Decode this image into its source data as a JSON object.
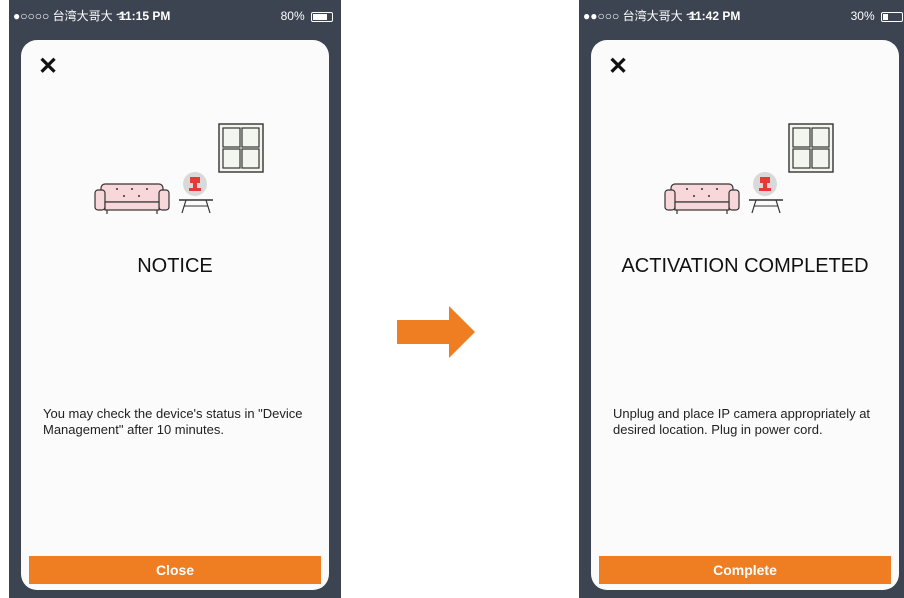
{
  "colors": {
    "accent": "#ef7d22",
    "phone_bg": "#3b4450",
    "card_bg": "#fbfbfb"
  },
  "left_screen": {
    "status": {
      "carrier": "●○○○○ 台湾大哥大 ᯤ",
      "time": "11:15 PM",
      "battery": "80%",
      "battery_level": 0.8
    },
    "title": "NOTICE",
    "description": "You may check the device's status in \"Device Management\" after 10 minutes.",
    "button_label": "Close"
  },
  "right_screen": {
    "status": {
      "carrier": "●●○○○ 台湾大哥大 ᯤ",
      "time": "11:42 PM",
      "battery": "30%",
      "battery_level": 0.3
    },
    "title": "ACTIVATION COMPLETED",
    "description": "Unplug and place IP camera appropriately at desired location. Plug in power cord.",
    "button_label": "Complete"
  },
  "icons": {
    "close": "close-icon",
    "transition": "arrow-right-icon",
    "illustration": "living-room-illustration"
  }
}
